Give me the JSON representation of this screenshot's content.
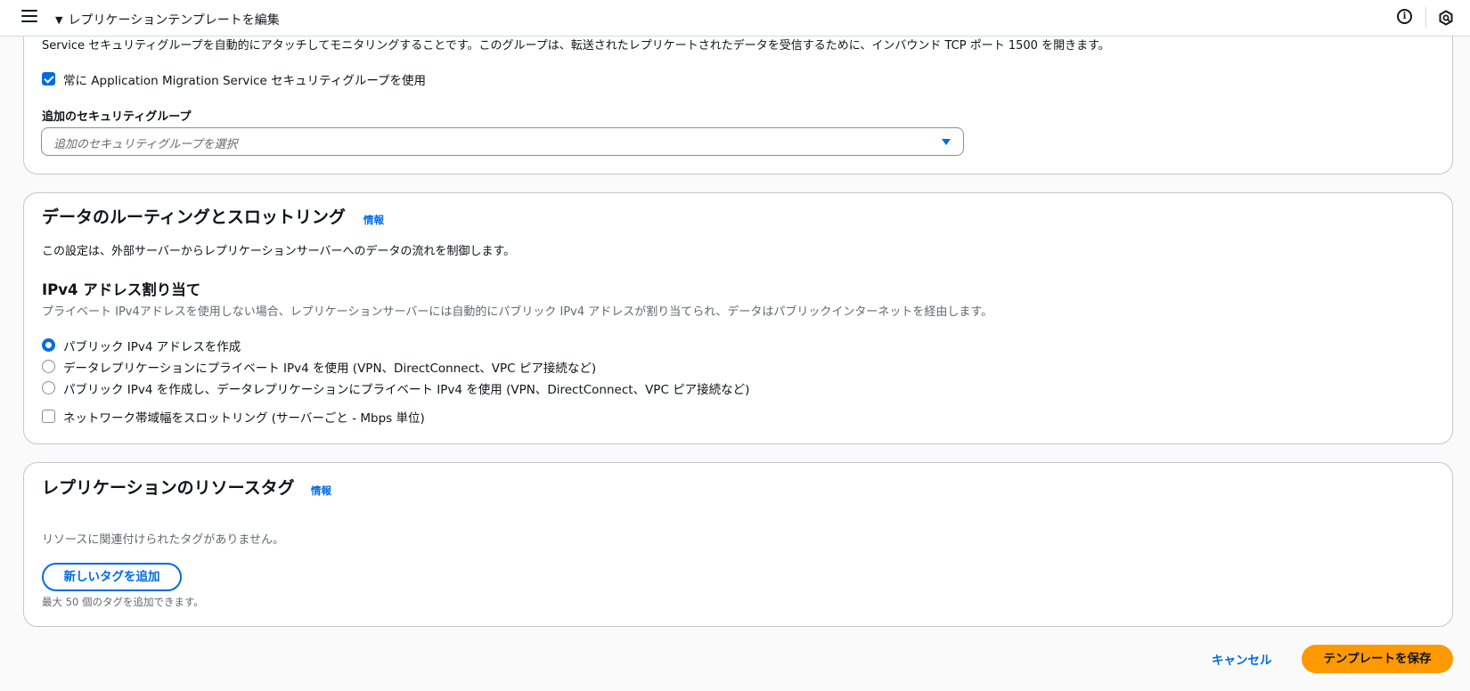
{
  "header": {
    "breadcrumb": "レプリケーションテンプレートを編集",
    "expand_glyph": "▼",
    "icons": [
      "menu-icon",
      "info-icon",
      "cloud-icon"
    ]
  },
  "security_group": {
    "description": "Service セキュリティグループを自動的にアタッチしてモニタリングすることです。このグループは、転送されたレプリケートされたデータを受信するために、インバウンド TCP ポート 1500 を開きます。",
    "always_use_label": "常に Application Migration Service セキュリティグループを使用",
    "always_use_checked": true,
    "additional_label": "追加のセキュリティグループ",
    "additional_placeholder": "追加のセキュリティグループを選択"
  },
  "routing": {
    "title": "データのルーティングとスロットリング",
    "info_link": "情報",
    "description": "この設定は、外部サーバーからレプリケーションサーバーへのデータの流れを制御します。",
    "ipv4_title": "IPv4 アドレス割り当て",
    "ipv4_description": "プライベート IPv4アドレスを使用しない場合、レプリケーションサーバーには自動的にパブリック IPv4 アドレスが割り当てられ、データはパブリックインターネットを経由します。",
    "options": [
      {
        "label": "パブリック IPv4 アドレスを作成",
        "selected": true
      },
      {
        "label": "データレプリケーションにプライベート IPv4 を使用 (VPN、DirectConnect、VPC ピア接続など)",
        "selected": false
      },
      {
        "label": "パブリック IPv4 を作成し、データレプリケーションにプライベート IPv4 を使用 (VPN、DirectConnect、VPC ピア接続など)",
        "selected": false
      }
    ],
    "throttle_label": "ネットワーク帯域幅をスロットリング (サーバーごと - Mbps 単位)",
    "throttle_checked": false
  },
  "tags": {
    "title": "レプリケーションのリソースタグ",
    "info_link": "情報",
    "empty_text": "リソースに関連付けられたタグがありません。",
    "add_button": "新しいタグを追加",
    "limit_text": "最大 50 個のタグを追加できます。"
  },
  "footer": {
    "cancel": "キャンセル",
    "save": "テンプレートを保存"
  },
  "colors": {
    "accent": "#006ce0",
    "primary_button": "#ff9900",
    "border": "#c6c6cd"
  }
}
